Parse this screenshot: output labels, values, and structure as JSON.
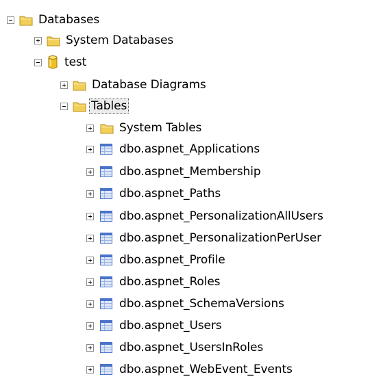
{
  "tree": {
    "root": {
      "label": "Databases",
      "icon": "folder-icon",
      "expanded": true
    },
    "system_databases": {
      "label": "System Databases",
      "icon": "folder-icon",
      "expanded": false
    },
    "database": {
      "label": "test",
      "icon": "database-icon",
      "expanded": true
    },
    "diagrams": {
      "label": "Database Diagrams",
      "icon": "folder-icon",
      "expanded": false
    },
    "tables_folder": {
      "label": "Tables",
      "icon": "folder-icon",
      "expanded": true,
      "selected": true
    },
    "system_tables": {
      "label": "System Tables",
      "icon": "folder-icon",
      "expanded": false
    },
    "tables": [
      "dbo.aspnet_Applications",
      "dbo.aspnet_Membership",
      "dbo.aspnet_Paths",
      "dbo.aspnet_PersonalizationAllUsers",
      "dbo.aspnet_PersonalizationPerUser",
      "dbo.aspnet_Profile",
      "dbo.aspnet_Roles",
      "dbo.aspnet_SchemaVersions",
      "dbo.aspnet_Users",
      "dbo.aspnet_UsersInRoles",
      "dbo.aspnet_WebEvent_Events"
    ],
    "table_icon": "table-icon"
  },
  "colors": {
    "folder": "#f2cf57",
    "folder_edge": "#b9901f",
    "table_blue": "#4a73c9",
    "table_light": "#dbe6f7",
    "database": "#f0c020",
    "selection_bg": "#ececec"
  }
}
